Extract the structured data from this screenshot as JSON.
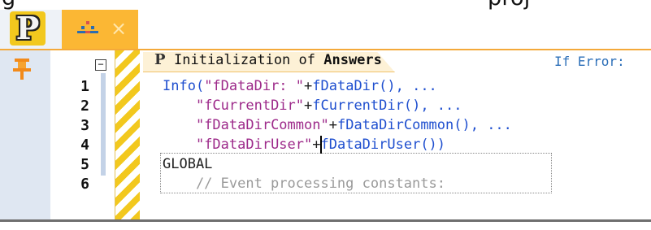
{
  "caption": {
    "left": "g",
    "right": "proj"
  },
  "tabs": {
    "p_tab_glyph": "P",
    "close_glyph": "×"
  },
  "colors": {
    "tab_accent": "#fbb734",
    "string": "#9d2a8a",
    "function": "#1f4fcf",
    "hatch": "#f2c81e"
  },
  "icons": [
    "pin-icon",
    "pattern-icon",
    "close-icon",
    "fold-toggle-icon"
  ],
  "section": {
    "glyph": "P",
    "title_prefix": "Initialization of ",
    "title_bold": "Answers",
    "right_label": "If Error:"
  },
  "gutter": {
    "fold_toggle": "−",
    "line_numbers": [
      "1",
      "2",
      "3",
      "4",
      "5",
      "6"
    ]
  },
  "code": {
    "l1_fn": "Info(",
    "l1_str": "\"fDataDir: \"",
    "l1_plus": "+",
    "l1_call": "fDataDir(), ...",
    "l2_indent": "    ",
    "l2_str": "\"fCurrentDir\"",
    "l2_plus": "+",
    "l2_call": "fCurrentDir(), ...",
    "l3_indent": "    ",
    "l3_str": "\"fDataDirCommon\"",
    "l3_plus": "+",
    "l3_call": "fDataDirCommon(), ...",
    "l4_indent": "    ",
    "l4_str": "\"fDataDirUser\"",
    "l4_plus": "+",
    "l4_call": "fDataDirUser())",
    "l5": "GLOBAL",
    "l6": "    // Event processing constants:"
  }
}
